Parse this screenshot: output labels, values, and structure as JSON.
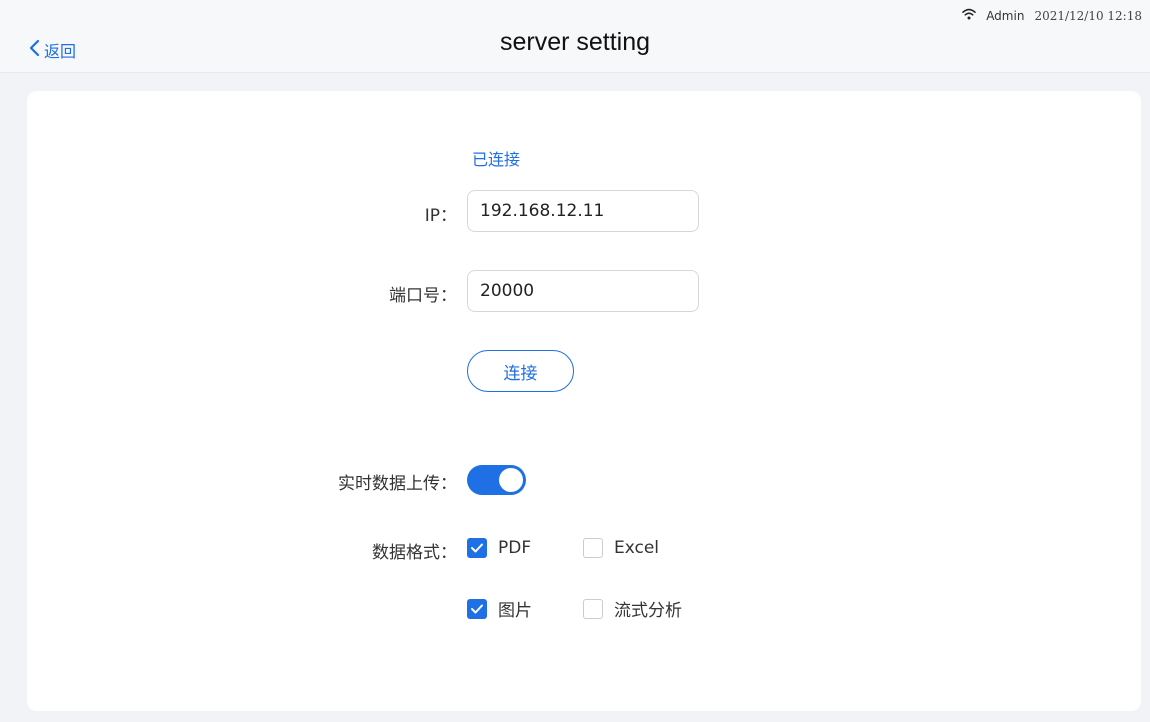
{
  "header": {
    "back_label": "返回",
    "title": "server setting",
    "user": "Admin",
    "datetime": "2021/12/10 12:18"
  },
  "connection": {
    "status": "已连接",
    "ip_label": "IP：",
    "ip_value": "192.168.12.11",
    "port_label": "端口号：",
    "port_value": "20000",
    "connect_label": "连接"
  },
  "upload": {
    "realtime_label": "实时数据上传：",
    "realtime_enabled": true
  },
  "format": {
    "label": "数据格式：",
    "options": [
      {
        "label": "PDF",
        "checked": true
      },
      {
        "label": "Excel",
        "checked": false
      },
      {
        "label": "图片",
        "checked": true
      },
      {
        "label": "流式分析",
        "checked": false
      }
    ]
  },
  "colors": {
    "accent": "#1f6fe5",
    "background": "#f1f3f6",
    "card": "#ffffff"
  }
}
